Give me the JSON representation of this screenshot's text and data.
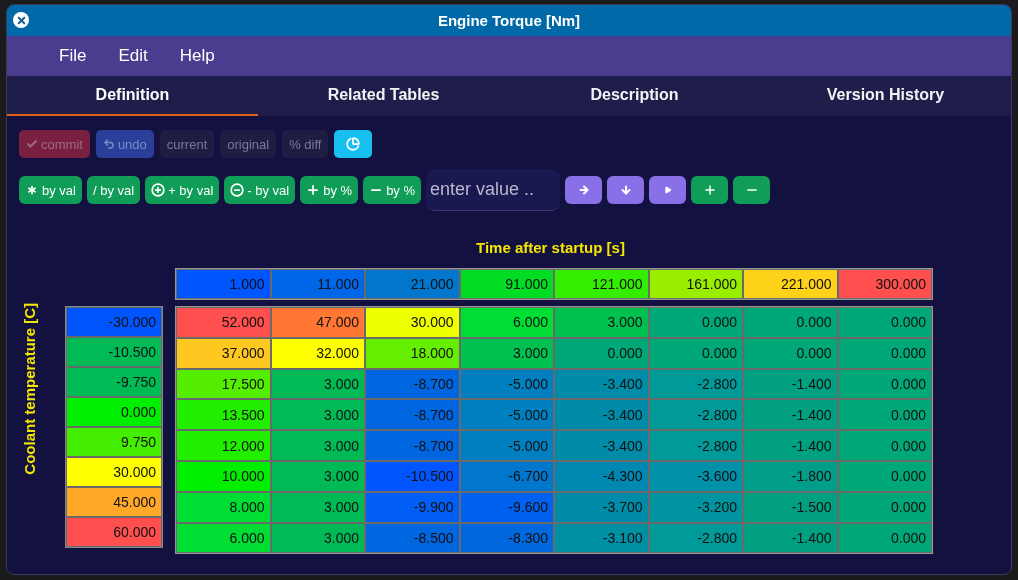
{
  "window": {
    "title": "Engine Torque [Nm]"
  },
  "menu": [
    "File",
    "Edit",
    "Help"
  ],
  "tabs": [
    {
      "label": "Definition",
      "selected": true
    },
    {
      "label": "Related Tables",
      "selected": false
    },
    {
      "label": "Description",
      "selected": false
    },
    {
      "label": "Version History",
      "selected": false
    }
  ],
  "toolbar_1": [
    {
      "kind": "commit",
      "label": "commit"
    },
    {
      "kind": "undo",
      "label": "undo"
    },
    {
      "kind": "view",
      "label": "current"
    },
    {
      "kind": "view",
      "label": "original"
    },
    {
      "kind": "view",
      "label": "% diff"
    },
    {
      "kind": "chart"
    }
  ],
  "toolbar_2": [
    {
      "kind": "multiply",
      "label": "by val"
    },
    {
      "kind": "divide",
      "label": "/ by val"
    },
    {
      "kind": "add",
      "label": "+ by val"
    },
    {
      "kind": "subtract",
      "label": "- by val"
    },
    {
      "kind": "add-percent",
      "label": "by %"
    },
    {
      "kind": "subtract-percent",
      "label": "by %"
    }
  ],
  "value_field": {
    "placeholder": "enter value .."
  },
  "icon_buttons": [
    {
      "kind": "fill-right"
    },
    {
      "kind": "fill-down"
    },
    {
      "kind": "step"
    },
    {
      "kind": "add"
    },
    {
      "kind": "remove"
    }
  ],
  "table": {
    "x_title": "Time after startup [s]",
    "y_title": "Coolant temperature [C]",
    "x_axis": [
      {
        "value": "1.000",
        "color": "#0055ff"
      },
      {
        "value": "11.000",
        "color": "#0066e8"
      },
      {
        "value": "21.000",
        "color": "#0077cc"
      },
      {
        "value": "91.000",
        "color": "#00dd22"
      },
      {
        "value": "121.000",
        "color": "#33ee00"
      },
      {
        "value": "161.000",
        "color": "#99ee00"
      },
      {
        "value": "221.000",
        "color": "#ffd21a"
      },
      {
        "value": "300.000",
        "color": "#ff4f4f"
      }
    ],
    "y_axis": [
      {
        "value": "-30.000",
        "color": "#0055ff"
      },
      {
        "value": "-10.500",
        "color": "#00bb55"
      },
      {
        "value": "-9.750",
        "color": "#00bb55"
      },
      {
        "value": "0.000",
        "color": "#00ee00"
      },
      {
        "value": "9.750",
        "color": "#44ee00"
      },
      {
        "value": "30.000",
        "color": "#ffff00"
      },
      {
        "value": "45.000",
        "color": "#ffa82a"
      },
      {
        "value": "60.000",
        "color": "#ff4f4f"
      }
    ],
    "rows": [
      [
        {
          "value": "52.000",
          "color": "#ff4f4f"
        },
        {
          "value": "47.000",
          "color": "#ff7733"
        },
        {
          "value": "30.000",
          "color": "#eeff00"
        },
        {
          "value": "6.000",
          "color": "#00dd33"
        },
        {
          "value": "3.000",
          "color": "#00c050"
        },
        {
          "value": "0.000",
          "color": "#00a878"
        },
        {
          "value": "0.000",
          "color": "#00a878"
        },
        {
          "value": "0.000",
          "color": "#00a878"
        }
      ],
      [
        {
          "value": "37.000",
          "color": "#ffc820"
        },
        {
          "value": "32.000",
          "color": "#ffff00"
        },
        {
          "value": "18.000",
          "color": "#66ee00"
        },
        {
          "value": "3.000",
          "color": "#00c050"
        },
        {
          "value": "0.000",
          "color": "#00a878"
        },
        {
          "value": "0.000",
          "color": "#00a878"
        },
        {
          "value": "0.000",
          "color": "#00a878"
        },
        {
          "value": "0.000",
          "color": "#00a878"
        }
      ],
      [
        {
          "value": "17.500",
          "color": "#55ee00"
        },
        {
          "value": "3.000",
          "color": "#00bb55"
        },
        {
          "value": "-8.700",
          "color": "#0066e0"
        },
        {
          "value": "-5.000",
          "color": "#0080c0"
        },
        {
          "value": "-3.400",
          "color": "#008ca8"
        },
        {
          "value": "-2.800",
          "color": "#009a98"
        },
        {
          "value": "-1.400",
          "color": "#00a080"
        },
        {
          "value": "0.000",
          "color": "#00a878"
        }
      ],
      [
        {
          "value": "13.500",
          "color": "#22ee00"
        },
        {
          "value": "3.000",
          "color": "#00bb55"
        },
        {
          "value": "-8.700",
          "color": "#0066e0"
        },
        {
          "value": "-5.000",
          "color": "#0080c0"
        },
        {
          "value": "-3.400",
          "color": "#008ca8"
        },
        {
          "value": "-2.800",
          "color": "#009a98"
        },
        {
          "value": "-1.400",
          "color": "#00a080"
        },
        {
          "value": "0.000",
          "color": "#00a878"
        }
      ],
      [
        {
          "value": "12.000",
          "color": "#22ee00"
        },
        {
          "value": "3.000",
          "color": "#00bb55"
        },
        {
          "value": "-8.700",
          "color": "#0066e0"
        },
        {
          "value": "-5.000",
          "color": "#0080c0"
        },
        {
          "value": "-3.400",
          "color": "#008ca8"
        },
        {
          "value": "-2.800",
          "color": "#009a98"
        },
        {
          "value": "-1.400",
          "color": "#00a080"
        },
        {
          "value": "0.000",
          "color": "#00a878"
        }
      ],
      [
        {
          "value": "10.000",
          "color": "#00ee00"
        },
        {
          "value": "3.000",
          "color": "#00bb55"
        },
        {
          "value": "-10.500",
          "color": "#0055ff"
        },
        {
          "value": "-6.700",
          "color": "#0077cc"
        },
        {
          "value": "-4.300",
          "color": "#0088b0"
        },
        {
          "value": "-3.600",
          "color": "#0090a8"
        },
        {
          "value": "-1.800",
          "color": "#009e88"
        },
        {
          "value": "0.000",
          "color": "#00a878"
        }
      ],
      [
        {
          "value": "8.000",
          "color": "#00dd33"
        },
        {
          "value": "3.000",
          "color": "#00bb55"
        },
        {
          "value": "-9.900",
          "color": "#005ef4"
        },
        {
          "value": "-9.600",
          "color": "#0060f0"
        },
        {
          "value": "-3.700",
          "color": "#008ca8"
        },
        {
          "value": "-3.200",
          "color": "#0094a0"
        },
        {
          "value": "-1.500",
          "color": "#00a080"
        },
        {
          "value": "0.000",
          "color": "#00a878"
        }
      ],
      [
        {
          "value": "6.000",
          "color": "#00dd33"
        },
        {
          "value": "3.000",
          "color": "#00bb55"
        },
        {
          "value": "-8.500",
          "color": "#0066e0"
        },
        {
          "value": "-8.300",
          "color": "#0068dc"
        },
        {
          "value": "-3.100",
          "color": "#0090a4"
        },
        {
          "value": "-2.800",
          "color": "#009a98"
        },
        {
          "value": "-1.400",
          "color": "#00a080"
        },
        {
          "value": "0.000",
          "color": "#00a878"
        }
      ]
    ]
  }
}
